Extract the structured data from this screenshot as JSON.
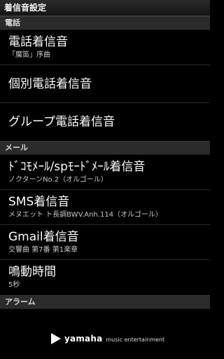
{
  "window": {
    "title": "着信音設定"
  },
  "sections": {
    "phone": "電話",
    "mail": "メール",
    "alarm": "アラーム"
  },
  "items": {
    "phone_ringtone": {
      "title": "電話着信音",
      "summary": "「魔笛」序曲"
    },
    "individual_ringtone": {
      "title": "個別電話着信音"
    },
    "group_ringtone": {
      "title": "グループ電話着信音"
    },
    "docomo_mail": {
      "title": "ﾄﾞｺﾓﾒｰﾙ/spﾓｰﾄﾞﾒｰﾙ着信音",
      "summary": "ノクターンNo.2（オルゴール）"
    },
    "sms": {
      "title": "SMS着信音",
      "summary": "メヌエット ト長調BWV.Anh.114（オルゴール）"
    },
    "gmail": {
      "title": "Gmail着信音",
      "summary": "交響曲 第7番 第1楽章"
    },
    "ring_duration": {
      "title": "鳴動時間",
      "summary": "5秒"
    }
  },
  "footer": {
    "brand_name": "yamaha",
    "brand_sub": "music entertainment",
    "logo_icon": "yamaha-play-triangle-icon"
  }
}
